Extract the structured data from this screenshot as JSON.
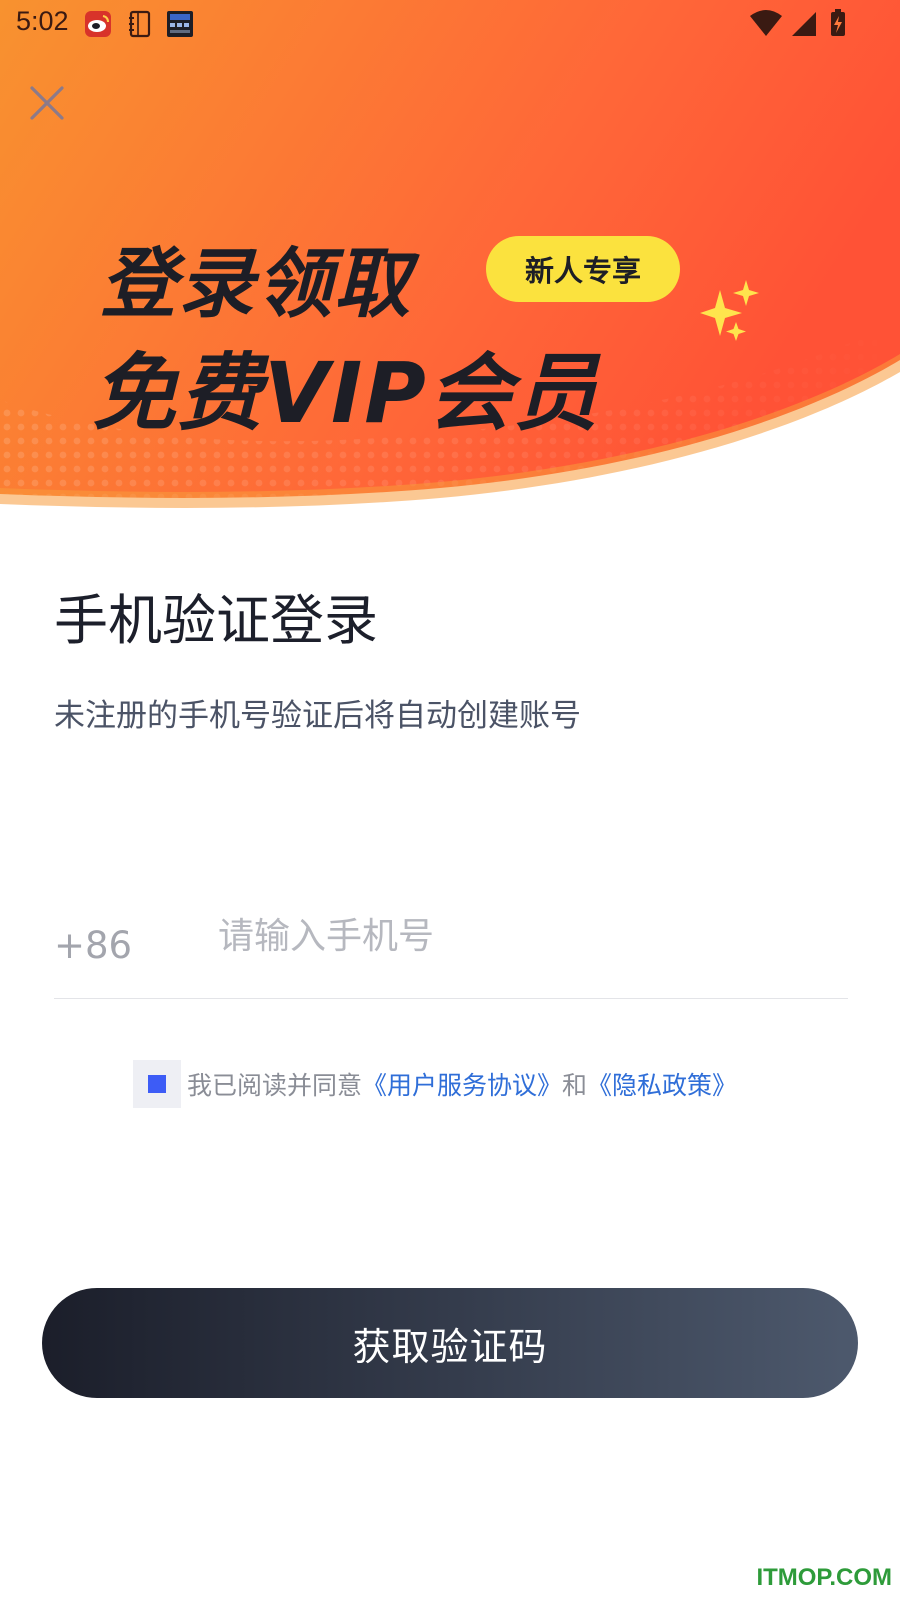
{
  "status_bar": {
    "time": "5:02",
    "app_icons": [
      "sina-icon",
      "notebook-icon",
      "clock-widget-icon"
    ],
    "system_icons": [
      "wifi-icon",
      "signal-icon",
      "battery-charging-icon"
    ]
  },
  "banner": {
    "headline_line1": "登录领取",
    "headline_line2": "免费VIP会员",
    "badge": "新人专享",
    "colors": {
      "gradient_start": "#f78a2e",
      "gradient_end": "#ff5b3a",
      "badge": "#fbe23e"
    }
  },
  "login": {
    "title": "手机验证登录",
    "subtitle": "未注册的手机号验证后将自动创建账号",
    "country_code": "+86",
    "phone_placeholder": "请输入手机号",
    "phone_value": ""
  },
  "agreement": {
    "prefix": "我已阅读并同意",
    "terms_link": "《用户服务协议》",
    "conjunction": "和",
    "privacy_link": "《隐私政策》"
  },
  "actions": {
    "get_code_label": "获取验证码"
  },
  "watermark": "ITMOP.COM"
}
